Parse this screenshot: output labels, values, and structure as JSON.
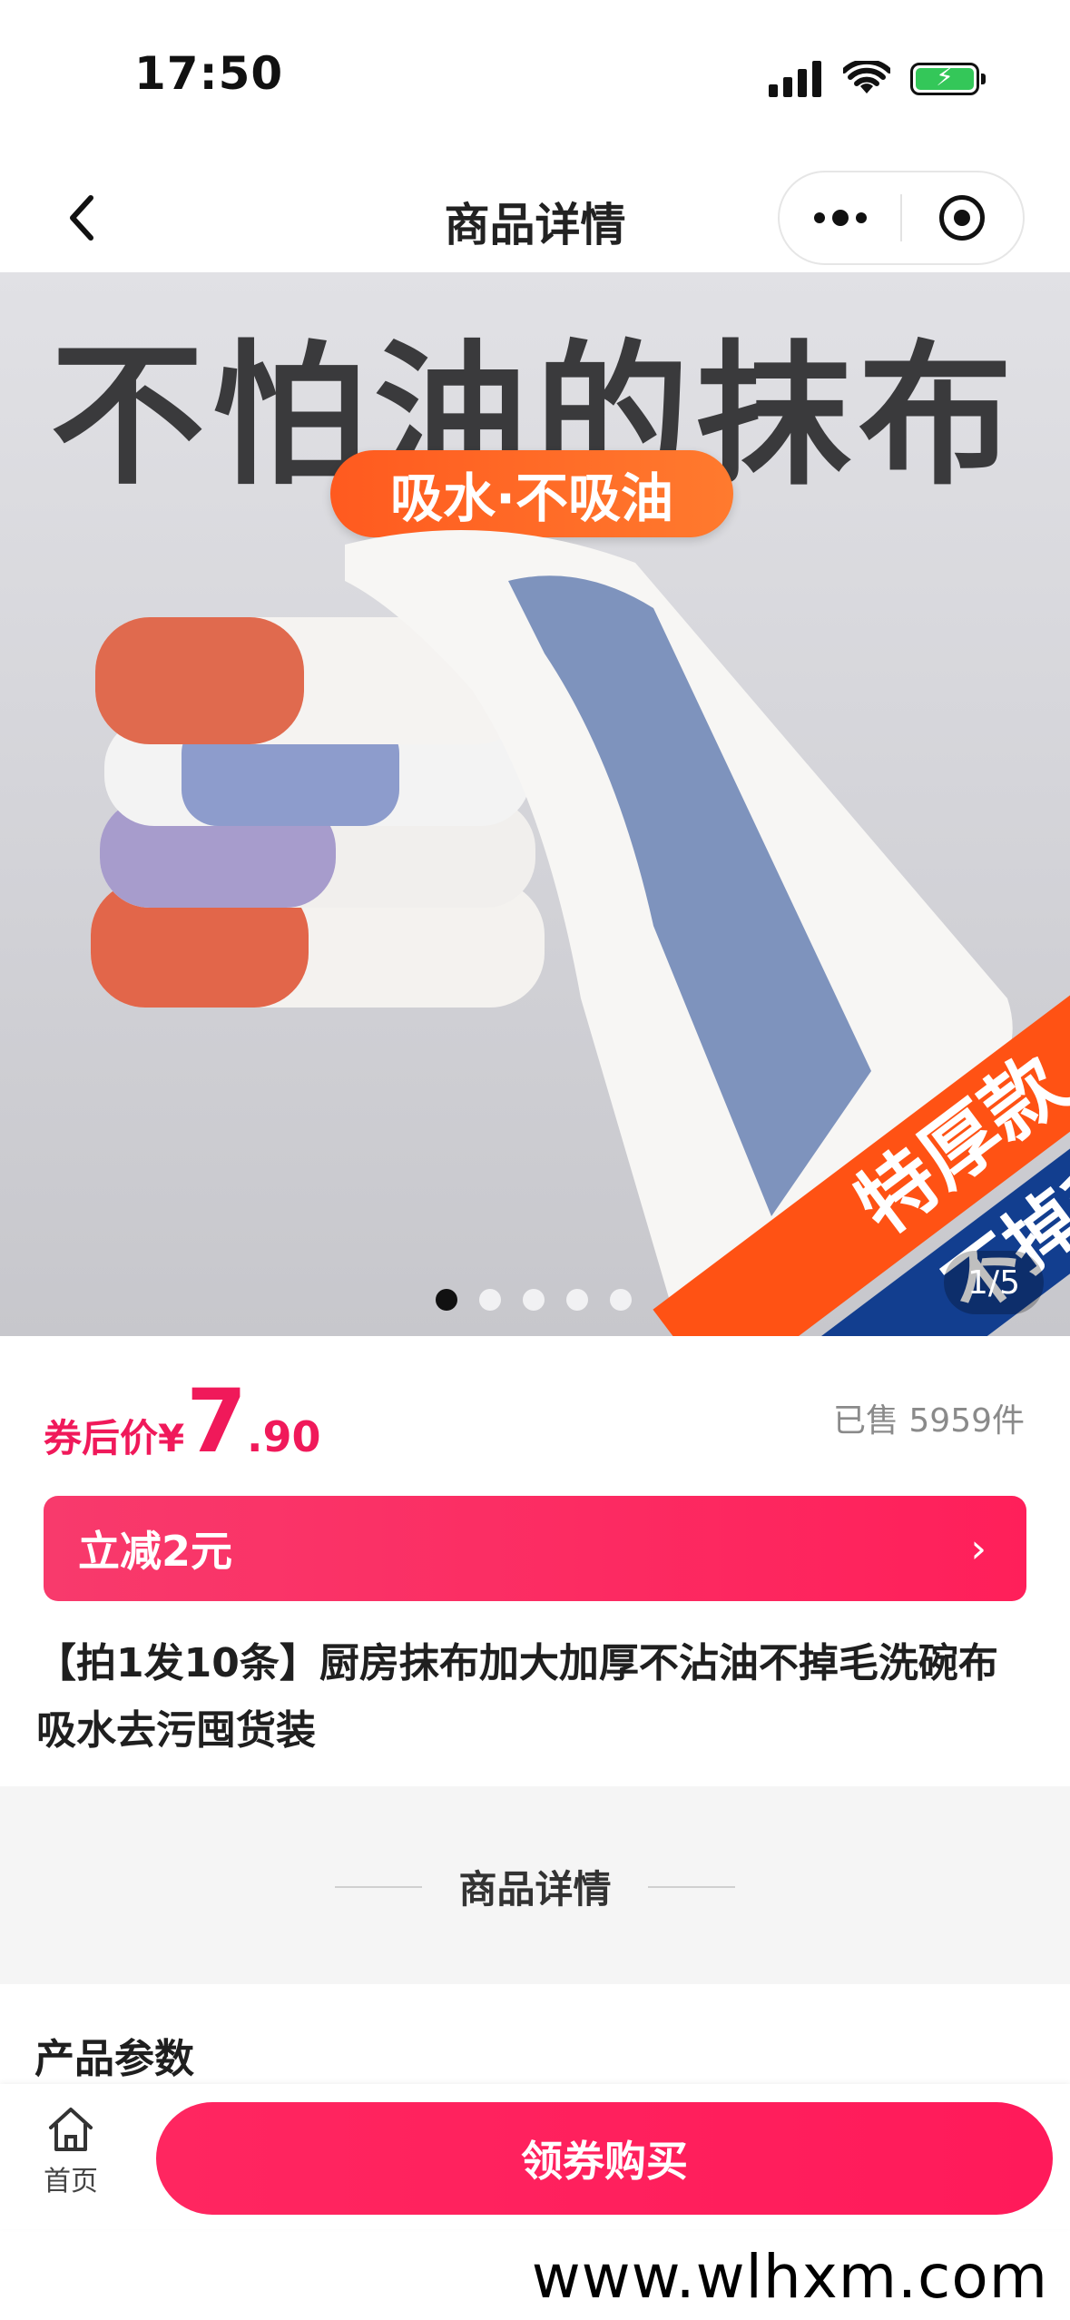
{
  "status_bar": {
    "time": "17:50"
  },
  "nav": {
    "title": "商品详情"
  },
  "hero": {
    "headline": "不怕油的抹布",
    "pill": "吸水·不吸油",
    "ribbon_1": "特厚款",
    "ribbon_2": "不掉毛",
    "page_counter": "1/5",
    "dots_total": 5,
    "dots_active": 1
  },
  "price": {
    "label": "券后价¥",
    "integer": "7",
    "decimal": ".90"
  },
  "sold": "已售 5959件",
  "coupon": {
    "text": "立减2元",
    "arrow": "›"
  },
  "product_title": "【拍1发10条】厨房抹布加大加厚不沾油不掉毛洗碗布吸水去污囤货装",
  "detail": {
    "heading": "商品详情",
    "params_title": "产品参数"
  },
  "bottom": {
    "home_label": "首页",
    "buy_label": "领券购买"
  },
  "watermark": "www.wlhxm.com",
  "colors": {
    "accent": "#f0195a",
    "ribbon_orange": "#ff5214",
    "ribbon_blue": "#123e8f",
    "pill_orange": "#ff6a24"
  }
}
